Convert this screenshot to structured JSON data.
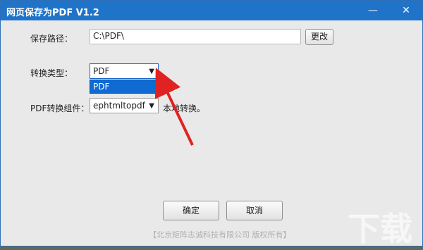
{
  "window": {
    "title": "网页保存为PDF  V1.2",
    "controls": {
      "minimize": "—",
      "close": "✕"
    }
  },
  "form": {
    "save_path_label": "保存路径：",
    "save_path_value": "C:\\PDF\\",
    "change_button": "更改",
    "convert_type_label": "转换类型：",
    "convert_type_value": "PDF",
    "dropdown_options": [
      "PDF"
    ],
    "component_label": "PDF转换组件：",
    "component_value": "ephtmltopdf",
    "component_note": "本地转换。"
  },
  "buttons": {
    "ok": "确定",
    "cancel": "取消"
  },
  "footer": "【北京矩阵志诚科技有限公司 版权所有】",
  "watermark": "下载"
}
